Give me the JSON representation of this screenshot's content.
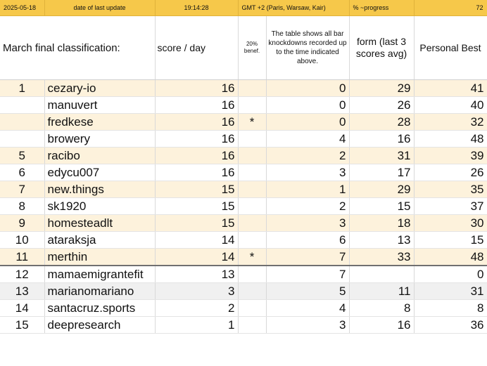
{
  "status_bar": {
    "date": "2025-05-18",
    "date_label": "date of last update",
    "time": "19:14:28",
    "timezone": "GMT +2 (Paris, Warsaw, Kair)",
    "progress_label": "% ~progress",
    "progress_value": "72"
  },
  "header": {
    "title": "March final classification:",
    "score_per_day": "score / day",
    "benefit_line1": "20%",
    "benefit_line2": "benef.",
    "note": "The table shows all bar knockdowns recorded up to the time indicated above.",
    "form": "form (last 3 scores avg)",
    "personal_best": "Personal Best"
  },
  "rows": [
    {
      "rank": "1",
      "name": "cezary-io",
      "score": "16",
      "benefit": "",
      "knockdowns": "0",
      "form": "29",
      "best": "41"
    },
    {
      "rank": "",
      "name": "manuvert",
      "score": "16",
      "benefit": "",
      "knockdowns": "0",
      "form": "26",
      "best": "40"
    },
    {
      "rank": "",
      "name": "fredkese",
      "score": "16",
      "benefit": "*",
      "knockdowns": "0",
      "form": "28",
      "best": "32"
    },
    {
      "rank": "",
      "name": "browery",
      "score": "16",
      "benefit": "",
      "knockdowns": "4",
      "form": "16",
      "best": "48"
    },
    {
      "rank": "5",
      "name": "racibo",
      "score": "16",
      "benefit": "",
      "knockdowns": "2",
      "form": "31",
      "best": "39"
    },
    {
      "rank": "6",
      "name": "edycu007",
      "score": "16",
      "benefit": "",
      "knockdowns": "3",
      "form": "17",
      "best": "26"
    },
    {
      "rank": "7",
      "name": "new.things",
      "score": "15",
      "benefit": "",
      "knockdowns": "1",
      "form": "29",
      "best": "35"
    },
    {
      "rank": "8",
      "name": "sk1920",
      "score": "15",
      "benefit": "",
      "knockdowns": "2",
      "form": "15",
      "best": "37"
    },
    {
      "rank": "9",
      "name": "homesteadlt",
      "score": "15",
      "benefit": "",
      "knockdowns": "3",
      "form": "18",
      "best": "30"
    },
    {
      "rank": "10",
      "name": "ataraksja",
      "score": "14",
      "benefit": "",
      "knockdowns": "6",
      "form": "13",
      "best": "15"
    },
    {
      "rank": "11",
      "name": "merthin",
      "score": "14",
      "benefit": "*",
      "knockdowns": "7",
      "form": "33",
      "best": "48"
    },
    {
      "rank": "12",
      "name": "mamaemigrantefit",
      "score": "13",
      "benefit": "",
      "knockdowns": "7",
      "form": "",
      "best": "0"
    },
    {
      "rank": "13",
      "name": "marianomariano",
      "score": "3",
      "benefit": "",
      "knockdowns": "5",
      "form": "11",
      "best": "31"
    },
    {
      "rank": "14",
      "name": "santacruz.sports",
      "score": "2",
      "benefit": "",
      "knockdowns": "4",
      "form": "8",
      "best": "8"
    },
    {
      "rank": "15",
      "name": "deepresearch",
      "score": "1",
      "benefit": "",
      "knockdowns": "3",
      "form": "16",
      "best": "36"
    }
  ]
}
